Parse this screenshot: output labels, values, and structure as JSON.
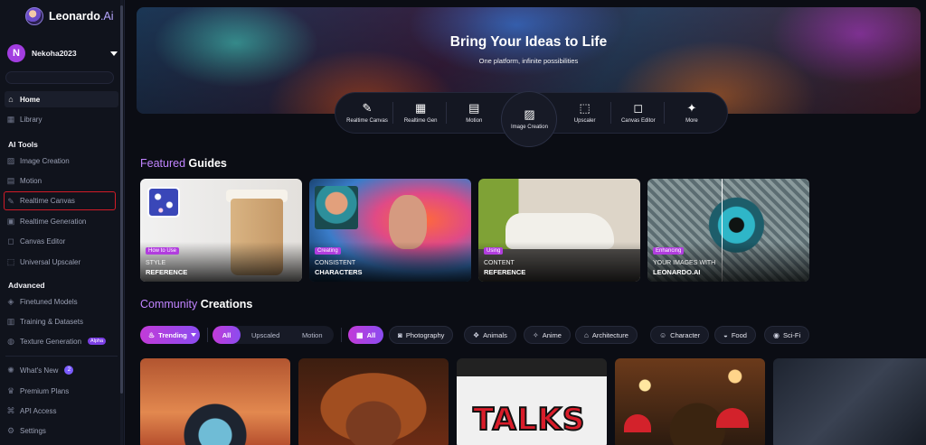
{
  "brand": {
    "name": "Leonardo",
    "suffix": ".Ai"
  },
  "user": {
    "initial": "N",
    "name": "Nekoha2023"
  },
  "sidebar": {
    "items": [
      {
        "label": "Home",
        "icon": "home-icon"
      },
      {
        "label": "Library",
        "icon": "grid-icon"
      }
    ],
    "ai_tools_title": "AI Tools",
    "ai_tools": [
      {
        "label": "Image Creation",
        "icon": "image-icon"
      },
      {
        "label": "Motion",
        "icon": "film-icon"
      },
      {
        "label": "Realtime Canvas",
        "icon": "brush-icon"
      },
      {
        "label": "Realtime Generation",
        "icon": "realtime-icon"
      },
      {
        "label": "Canvas Editor",
        "icon": "canvas-icon"
      },
      {
        "label": "Universal Upscaler",
        "icon": "upscale-icon"
      }
    ],
    "advanced_title": "Advanced",
    "advanced": [
      {
        "label": "Finetuned Models",
        "icon": "model-icon"
      },
      {
        "label": "Training & Datasets",
        "icon": "dataset-icon"
      },
      {
        "label": "Texture Generation",
        "icon": "texture-icon",
        "badge": "Alpha"
      }
    ],
    "footer": [
      {
        "label": "What's New",
        "icon": "gear-icon",
        "badge": "2"
      },
      {
        "label": "Premium Plans",
        "icon": "crown-icon"
      },
      {
        "label": "API Access",
        "icon": "api-icon"
      },
      {
        "label": "Settings",
        "icon": "settings-icon"
      }
    ]
  },
  "hero": {
    "title": "Bring Your Ideas to Life",
    "subtitle": "One platform, infinite possibilities"
  },
  "tools": [
    {
      "label": "Realtime Canvas",
      "glyph": "✎"
    },
    {
      "label": "Realtime Gen",
      "glyph": "▦"
    },
    {
      "label": "Motion",
      "glyph": "▤"
    },
    {
      "label": "Image Creation",
      "glyph": "▨"
    },
    {
      "label": "Upscaler",
      "glyph": "⬚"
    },
    {
      "label": "Canvas Editor",
      "glyph": "◻"
    },
    {
      "label": "More",
      "glyph": "✦"
    }
  ],
  "featured": {
    "accent": "Featured",
    "rest": " Guides"
  },
  "guides": [
    {
      "tag": "How to Use",
      "line1": "Style",
      "line2": "Reference"
    },
    {
      "tag": "Creating",
      "line1": "Consistent",
      "line2": "Characters"
    },
    {
      "tag": "Using",
      "line1": "Content",
      "line2": "Reference"
    },
    {
      "tag": "Enhancing",
      "line1": "Your images with",
      "line2": "Leonardo.Ai"
    }
  ],
  "community": {
    "accent": "Community",
    "rest": " Creations"
  },
  "filters": {
    "sort": "Trending",
    "scope": [
      "All",
      "Upscaled",
      "Motion"
    ],
    "categories": [
      "All",
      "Photography",
      "Animals",
      "Anime",
      "Architecture",
      "Character",
      "Food",
      "Sci-Fi"
    ]
  },
  "cards": [
    {
      "text": ""
    },
    {
      "text": ""
    },
    {
      "text": "TALKS"
    },
    {
      "text": ""
    },
    {
      "text": ""
    }
  ],
  "colors": {
    "accent": "#c184ff",
    "highlight_border": "#d11b27",
    "pill_gradient_start": "#c23bd8",
    "pill_gradient_end": "#8a4cf0"
  }
}
